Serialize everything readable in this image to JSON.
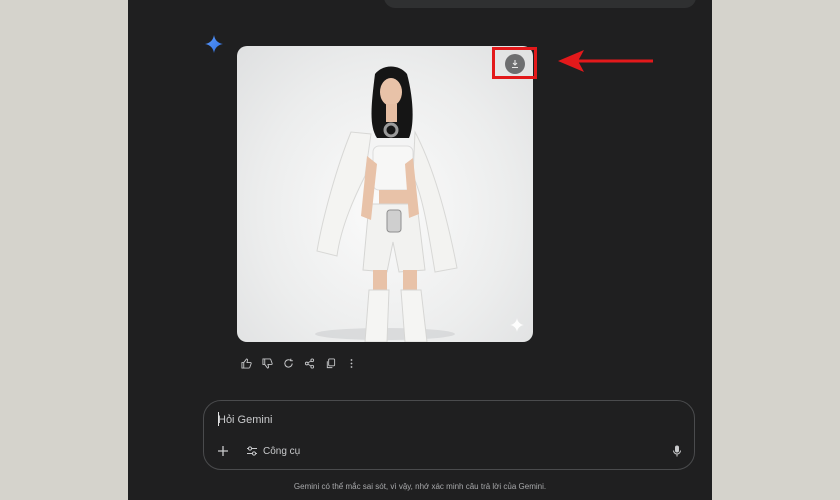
{
  "composer": {
    "placeholder": "Hỏi Gemini",
    "tools_label": "Công cụ"
  },
  "footer": {
    "disclaimer": "Gemini có thể mắc sai sót, vì vậy, nhớ xác minh câu trả lời của Gemini."
  },
  "response": {
    "actions": [
      "thumbs-up-icon",
      "thumbs-down-icon",
      "regenerate-icon",
      "share-icon",
      "copy-icon",
      "more-icon"
    ]
  },
  "colors": {
    "app_bg": "#1f1f20",
    "outer_bg": "#d5d3cc",
    "highlight": "#e3191b",
    "gemini_sparkle": "#4c8df6"
  }
}
